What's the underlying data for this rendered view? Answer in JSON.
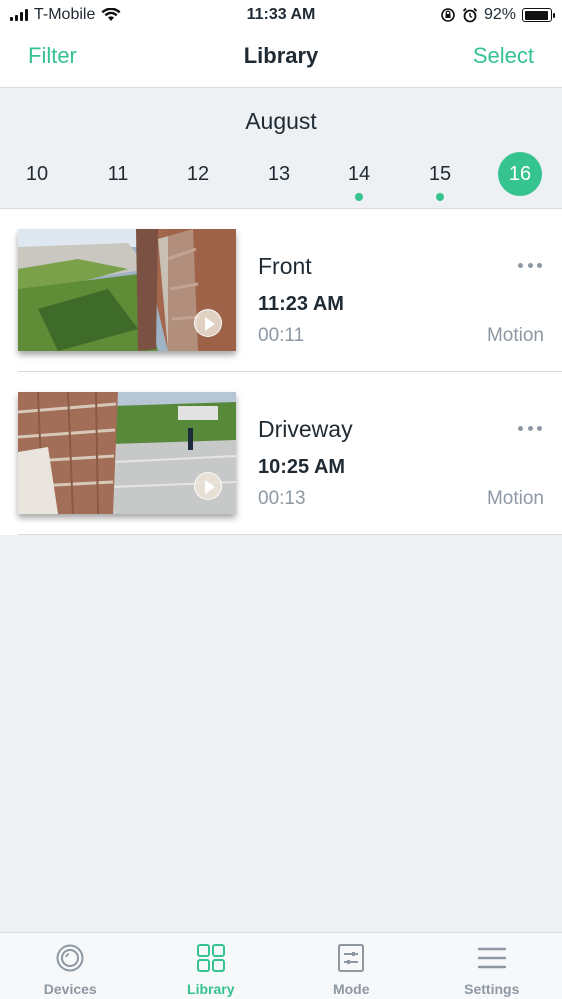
{
  "status_bar": {
    "carrier": "T-Mobile",
    "time": "11:33 AM",
    "battery": "92%",
    "battery_level": 0.92
  },
  "nav": {
    "filter_label": "Filter",
    "title": "Library",
    "select_label": "Select"
  },
  "date_strip": {
    "month": "August",
    "days": [
      {
        "label": "10",
        "has_clips": false,
        "selected": false
      },
      {
        "label": "11",
        "has_clips": false,
        "selected": false
      },
      {
        "label": "12",
        "has_clips": false,
        "selected": false
      },
      {
        "label": "13",
        "has_clips": false,
        "selected": false
      },
      {
        "label": "14",
        "has_clips": true,
        "selected": false
      },
      {
        "label": "15",
        "has_clips": true,
        "selected": false
      },
      {
        "label": "16",
        "has_clips": false,
        "selected": true
      }
    ]
  },
  "clips": [
    {
      "camera": "Front",
      "time": "11:23 AM",
      "duration": "00:11",
      "event": "Motion"
    },
    {
      "camera": "Driveway",
      "time": "10:25 AM",
      "duration": "00:13",
      "event": "Motion"
    }
  ],
  "tabs": [
    {
      "label": "Devices",
      "icon": "devices-icon",
      "active": false
    },
    {
      "label": "Library",
      "icon": "library-grid-icon",
      "active": true
    },
    {
      "label": "Mode",
      "icon": "mode-sliders-icon",
      "active": false
    },
    {
      "label": "Settings",
      "icon": "settings-menu-icon",
      "active": false
    }
  ],
  "colors": {
    "accent": "#35c38f",
    "text": "#1f2a33",
    "muted": "#8d98a3",
    "background": "#eef1f4"
  }
}
